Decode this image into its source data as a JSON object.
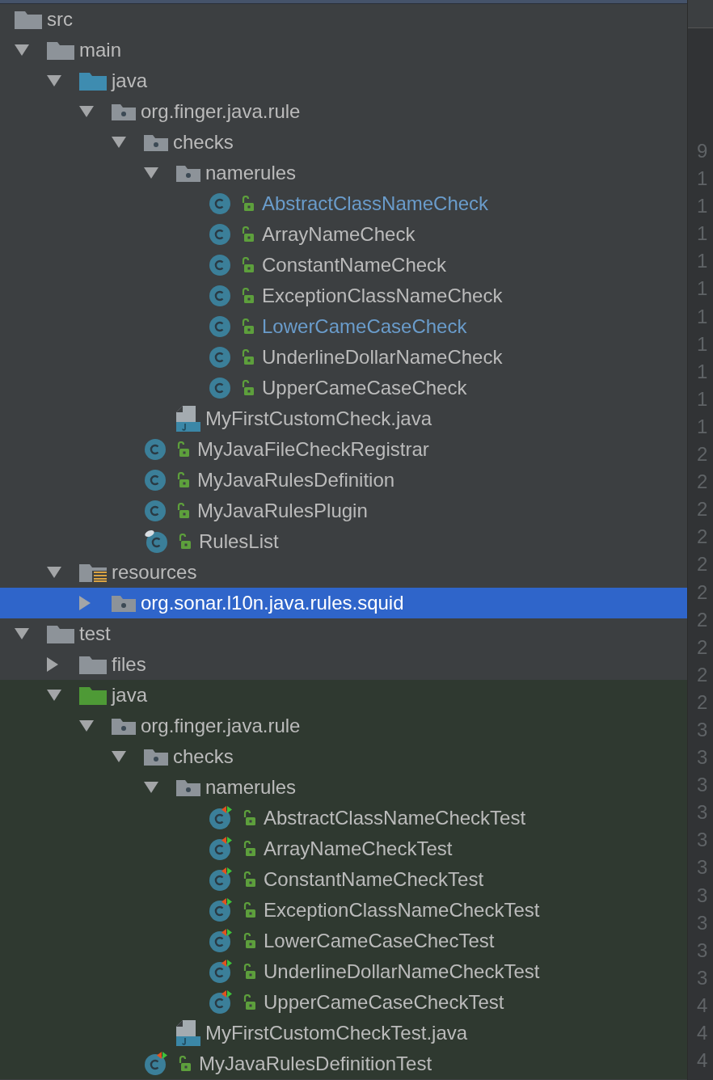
{
  "project_tree": {
    "nodes": [
      {
        "label": "src",
        "kind": "folder",
        "selected": false,
        "children": [
          {
            "label": "main",
            "kind": "folder",
            "expanded": true,
            "selected": false,
            "children": [
              {
                "label": "java",
                "kind": "source_folder",
                "expanded": true,
                "selected": false,
                "children": [
                  {
                    "label": "org.finger.java.rule",
                    "kind": "package",
                    "expanded": true,
                    "selected": false,
                    "children": [
                      {
                        "label": "checks",
                        "kind": "package",
                        "expanded": true,
                        "selected": false,
                        "children": [
                          {
                            "label": "namerules",
                            "kind": "package",
                            "expanded": true,
                            "selected": false,
                            "children": [
                              {
                                "label": "AbstractClassNameCheck",
                                "kind": "class",
                                "selected": false,
                                "modified": true
                              },
                              {
                                "label": "ArrayNameCheck",
                                "kind": "class",
                                "selected": false,
                                "modified": false
                              },
                              {
                                "label": "ConstantNameCheck",
                                "kind": "class",
                                "selected": false,
                                "modified": false
                              },
                              {
                                "label": "ExceptionClassNameCheck",
                                "kind": "class",
                                "selected": false,
                                "modified": false
                              },
                              {
                                "label": "LowerCameCaseCheck",
                                "kind": "class",
                                "selected": false,
                                "modified": true
                              },
                              {
                                "label": "UnderlineDollarNameCheck",
                                "kind": "class",
                                "selected": false,
                                "modified": false
                              },
                              {
                                "label": "UpperCameCaseCheck",
                                "kind": "class",
                                "selected": false,
                                "modified": false
                              }
                            ]
                          },
                          {
                            "label": "MyFirstCustomCheck.java",
                            "kind": "java_file",
                            "selected": false,
                            "modified": false
                          }
                        ]
                      },
                      {
                        "label": "MyJavaFileCheckRegistrar",
                        "kind": "class",
                        "selected": false,
                        "modified": false
                      },
                      {
                        "label": "MyJavaRulesDefinition",
                        "kind": "class",
                        "selected": false,
                        "modified": false
                      },
                      {
                        "label": "MyJavaRulesPlugin",
                        "kind": "class",
                        "selected": false,
                        "modified": false
                      },
                      {
                        "label": "RulesList",
                        "kind": "class_pinned",
                        "selected": false,
                        "modified": false
                      }
                    ]
                  }
                ]
              },
              {
                "label": "resources",
                "kind": "resources_folder",
                "expanded": true,
                "selected": false,
                "children": [
                  {
                    "label": "org.sonar.l10n.java.rules.squid",
                    "kind": "package",
                    "expanded": false,
                    "selected": true
                  }
                ]
              }
            ]
          },
          {
            "label": "test",
            "kind": "folder",
            "expanded": true,
            "selected": false,
            "children": [
              {
                "label": "files",
                "kind": "folder",
                "expanded": false,
                "selected": false
              },
              {
                "label": "java",
                "kind": "test_folder",
                "expanded": true,
                "selected": false,
                "test_sources": true,
                "children": [
                  {
                    "label": "org.finger.java.rule",
                    "kind": "package",
                    "expanded": true,
                    "selected": false,
                    "children": [
                      {
                        "label": "checks",
                        "kind": "package",
                        "expanded": true,
                        "selected": false,
                        "children": [
                          {
                            "label": "namerules",
                            "kind": "package",
                            "expanded": true,
                            "selected": false,
                            "children": [
                              {
                                "label": "AbstractClassNameCheckTest",
                                "kind": "test_class",
                                "selected": false,
                                "modified": false
                              },
                              {
                                "label": "ArrayNameCheckTest",
                                "kind": "test_class",
                                "selected": false,
                                "modified": false
                              },
                              {
                                "label": "ConstantNameCheckTest",
                                "kind": "test_class",
                                "selected": false,
                                "modified": false
                              },
                              {
                                "label": "ExceptionClassNameCheckTest",
                                "kind": "test_class",
                                "selected": false,
                                "modified": false
                              },
                              {
                                "label": "LowerCameCaseChecTest",
                                "kind": "test_class",
                                "selected": false,
                                "modified": false
                              },
                              {
                                "label": "UnderlineDollarNameCheckTest",
                                "kind": "test_class",
                                "selected": false,
                                "modified": false
                              },
                              {
                                "label": "UpperCameCaseCheckTest",
                                "kind": "test_class",
                                "selected": false,
                                "modified": false
                              }
                            ]
                          },
                          {
                            "label": "MyFirstCustomCheckTest.java",
                            "kind": "java_file",
                            "selected": false,
                            "modified": false
                          }
                        ]
                      },
                      {
                        "label": "MyJavaRulesDefinitionTest",
                        "kind": "test_class",
                        "selected": false,
                        "modified": false
                      }
                    ]
                  }
                ]
              }
            ]
          }
        ]
      }
    ]
  },
  "editor_gutter": {
    "line_numbers": [
      "9",
      "1",
      "1",
      "1",
      "1",
      "1",
      "1",
      "1",
      "1",
      "1",
      "1",
      "2",
      "2",
      "2",
      "2",
      "2",
      "2",
      "2",
      "2",
      "2",
      "2",
      "3",
      "3",
      "3",
      "3",
      "3",
      "3",
      "3",
      "3",
      "3",
      "3",
      "4",
      "4",
      "4"
    ]
  }
}
